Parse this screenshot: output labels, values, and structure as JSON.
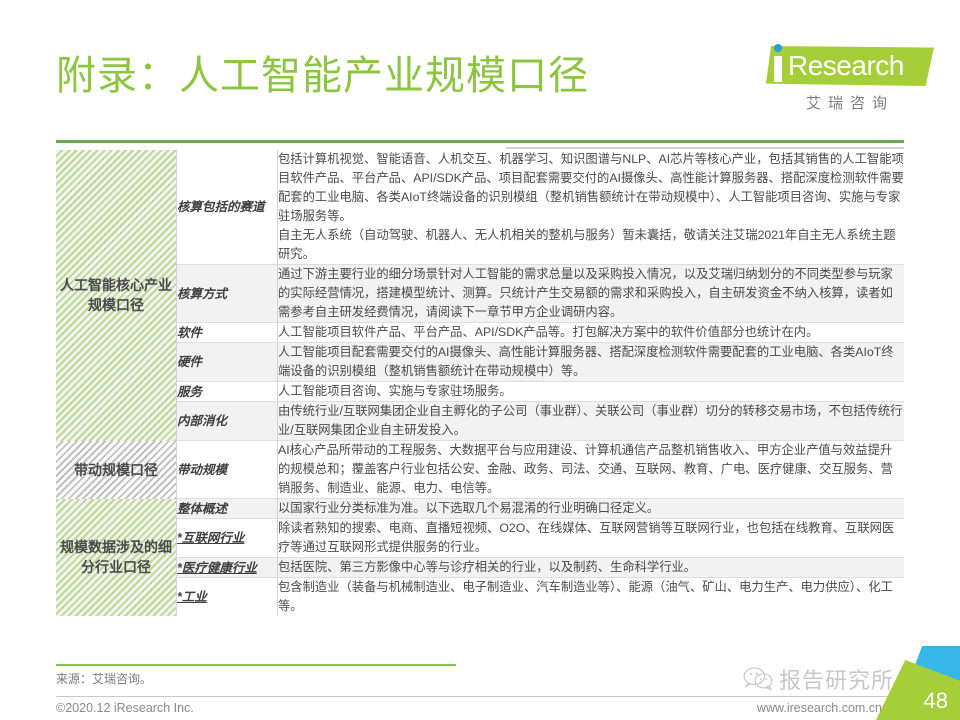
{
  "header": {
    "title": "附录：人工智能产业规模口径"
  },
  "logo": {
    "mark_text": "Research",
    "i_letter": "i",
    "chinese": "艾瑞咨询"
  },
  "table": {
    "groups": [
      {
        "name": "人工智能核心产业规模口径",
        "stripe": "green",
        "rows": [
          {
            "label": "核算包括的赛道",
            "underline": false,
            "shade": "white",
            "paragraphs": [
              "包括计算机视觉、智能语音、人机交互、机器学习、知识图谱与NLP、AI芯片等核心产业，包括其销售的人工智能项目软件产品、平台产品、API/SDK产品、项目配套需要交付的AI摄像头、高性能计算服务器、搭配深度检测软件需要配套的工业电脑、各类AIoT终端设备的识别模组（整机销售额统计在带动规模中）、人工智能项目咨询、实施与专家驻场服务等。",
              "自主无人系统（自动驾驶、机器人、无人机相关的整机与服务）暂未囊括，敬请关注艾瑞2021年自主无人系统主题研究。"
            ]
          },
          {
            "label": "核算方式",
            "underline": false,
            "shade": "gray",
            "paragraphs": [
              "通过下游主要行业的细分场景针对人工智能的需求总量以及采购投入情况，以及艾瑞归纳划分的不同类型参与玩家的实际经营情况，搭建模型统计、测算。只统计产生交易额的需求和采购投入，自主研发资金不纳入核算，读者如需参考自主研发经费情况，请阅读下一章节甲方企业调研内容。"
            ]
          },
          {
            "label": "软件",
            "underline": false,
            "shade": "white",
            "paragraphs": [
              "人工智能项目软件产品、平台产品、API/SDK产品等。打包解决方案中的软件价值部分也统计在内。"
            ]
          },
          {
            "label": "硬件",
            "underline": false,
            "shade": "gray",
            "paragraphs": [
              "人工智能项目配套需要交付的AI摄像头、高性能计算服务器、搭配深度检测软件需要配套的工业电脑、各类AIoT终端设备的识别模组（整机销售额统计在带动规模中）等。"
            ]
          },
          {
            "label": "服务",
            "underline": false,
            "shade": "white",
            "paragraphs": [
              "人工智能项目咨询、实施与专家驻场服务。"
            ]
          },
          {
            "label": "内部消化",
            "underline": false,
            "shade": "gray",
            "paragraphs": [
              "由传统行业/互联网集团企业自主孵化的子公司（事业群）、关联公司（事业群）切分的转移交易市场，不包括传统行业/互联网集团企业自主研发投入。"
            ]
          }
        ]
      },
      {
        "name": "带动规模口径",
        "stripe": "gray",
        "rows": [
          {
            "label": "带动规模",
            "underline": false,
            "shade": "white",
            "paragraphs": [
              "AI核心产品所带动的工程服务、大数据平台与应用建设、计算机通信产品整机销售收入、甲方企业产值与效益提升的规模总和；覆盖客户行业包括公安、金融、政务、司法、交通、互联网、教育、广电、医疗健康、交互服务、营销服务、制造业、能源、电力、电信等。"
            ]
          }
        ]
      },
      {
        "name": "规模数据涉及的细分行业口径",
        "stripe": "green",
        "rows": [
          {
            "label": "整体概述",
            "underline": false,
            "shade": "gray",
            "paragraphs": [
              "以国家行业分类标准为准。以下选取几个易混淆的行业明确口径定义。"
            ]
          },
          {
            "label": "*互联网行业",
            "underline": true,
            "shade": "white",
            "paragraphs": [
              "除读者熟知的搜索、电商、直播短视频、O2O、在线媒体、互联网营销等互联网行业，也包括在线教育、互联网医疗等通过互联网形式提供服务的行业。"
            ]
          },
          {
            "label": "*医疗健康行业",
            "underline": true,
            "shade": "gray",
            "paragraphs": [
              "包括医院、第三方影像中心等与诊疗相关的行业，以及制药、生命科学行业。"
            ]
          },
          {
            "label": "*工业",
            "underline": true,
            "shade": "white",
            "paragraphs": [
              "包含制造业（装备与机械制造业、电子制造业、汽车制造业等）、能源（油气、矿山、电力生产、电力供应）、化工等。"
            ]
          }
        ]
      }
    ]
  },
  "footer": {
    "source": "来源：艾瑞咨询。",
    "copyright": "©2020.12 iResearch Inc.",
    "url": "www.iresearch.com.cn",
    "page_number": "48",
    "watermark": "报告研究所"
  },
  "colors": {
    "accent_green": "#8cc63e",
    "logo_green": "#a6ce39",
    "logo_blue": "#2c9ad6",
    "corner_blue": "#35b7e8",
    "row_gray": "#f2f2f2"
  }
}
